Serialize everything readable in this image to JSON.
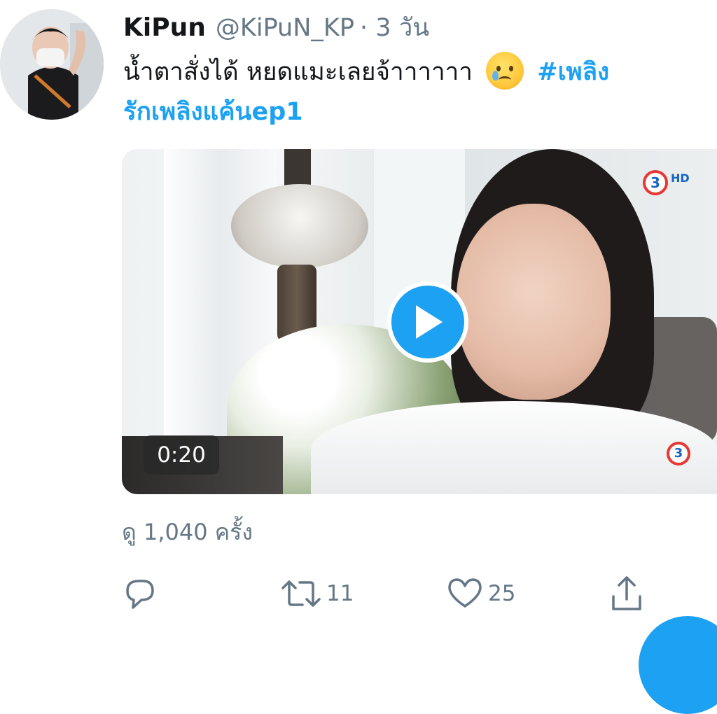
{
  "tweet": {
    "display_name": "KiPun",
    "handle": "@KiPuN_KP",
    "time_label": "· 3 วัน",
    "text_main": "น้ำตาสั่งได้ หยดแมะเลยจ้าาาาาา",
    "hashtag_line1": "#เพลิง",
    "hashtag_line2": "รักเพลิงแค้นep1",
    "emoji_name": "crying-face"
  },
  "media": {
    "type": "video",
    "duration": "0:20",
    "channel_logo_text": "3",
    "channel_logo_sub": "HD",
    "play_icon": "play-icon"
  },
  "stats": {
    "views_label": "ดู 1,040 ครั้ง"
  },
  "actions": {
    "reply_count": "",
    "retweet_count": "11",
    "like_count": "25",
    "icons": [
      "reply-icon",
      "retweet-icon",
      "like-icon",
      "share-icon"
    ]
  },
  "colors": {
    "accent": "#1da1f2",
    "text": "#14171a",
    "muted": "#657786"
  }
}
